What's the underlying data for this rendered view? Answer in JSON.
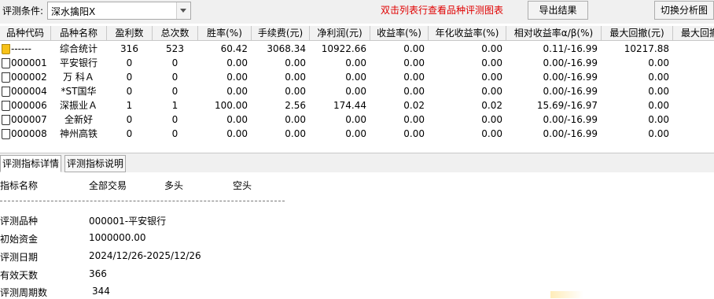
{
  "toolbar": {
    "condition_label": "评测条件:",
    "condition_value": "深水擒阳X",
    "hint": "双击列表行查看品种评测图表",
    "export_label": "导出结果",
    "switch_label": "切换分析图"
  },
  "table": {
    "columns": [
      "品种代码",
      "品种名称",
      "盈利数",
      "总次数",
      "胜率(%)",
      "手续费(元)",
      "净利润(元)",
      "收益率(%)",
      "年化收益率(%)",
      "相对收益率α/β(%)",
      "最大回撤(元)",
      "最大回撤"
    ],
    "rows": [
      {
        "code": "------",
        "name": "综合统计",
        "win": "316",
        "total": "523",
        "rate": "60.42",
        "fee": "3068.34",
        "profit": "10922.66",
        "ret": "0.00",
        "annual": "0.00",
        "rel": "0.11/-16.99",
        "dd": "10217.88",
        "summary": true
      },
      {
        "code": "000001",
        "name": "平安银行",
        "win": "0",
        "total": "0",
        "rate": "0.00",
        "fee": "0.00",
        "profit": "0.00",
        "ret": "0.00",
        "annual": "0.00",
        "rel": "0.00/-16.99",
        "dd": "0.00"
      },
      {
        "code": "000002",
        "name": "万 科Ａ",
        "win": "0",
        "total": "0",
        "rate": "0.00",
        "fee": "0.00",
        "profit": "0.00",
        "ret": "0.00",
        "annual": "0.00",
        "rel": "0.00/-16.99",
        "dd": "0.00"
      },
      {
        "code": "000004",
        "name": "*ST国华",
        "win": "0",
        "total": "0",
        "rate": "0.00",
        "fee": "0.00",
        "profit": "0.00",
        "ret": "0.00",
        "annual": "0.00",
        "rel": "0.00/-16.99",
        "dd": "0.00"
      },
      {
        "code": "000006",
        "name": "深振业Ａ",
        "win": "1",
        "total": "1",
        "rate": "100.00",
        "fee": "2.56",
        "profit": "174.44",
        "ret": "0.02",
        "annual": "0.02",
        "rel": "15.69/-16.97",
        "dd": "0.00"
      },
      {
        "code": "000007",
        "name": "全新好",
        "win": "0",
        "total": "0",
        "rate": "0.00",
        "fee": "0.00",
        "profit": "0.00",
        "ret": "0.00",
        "annual": "0.00",
        "rel": "0.00/-16.99",
        "dd": "0.00"
      },
      {
        "code": "000008",
        "name": "神州高铁",
        "win": "0",
        "total": "0",
        "rate": "0.00",
        "fee": "0.00",
        "profit": "0.00",
        "ret": "0.00",
        "annual": "0.00",
        "rel": "0.00/-16.99",
        "dd": "0.00"
      }
    ]
  },
  "tabs": [
    "评测指标详情",
    "评测指标说明"
  ],
  "detail": {
    "headers": [
      "指标名称",
      "全部交易",
      "多头",
      "空头"
    ],
    "rows": [
      {
        "label": "评测品种",
        "value": "000001-平安银行"
      },
      {
        "label": "初始资金",
        "value": "1000000.00"
      },
      {
        "label": "评测日期",
        "value": "2024/12/26-2025/12/26"
      },
      {
        "label": "有效天数",
        "value": "366"
      },
      {
        "label": "评测周期数",
        "value": "344"
      }
    ]
  }
}
